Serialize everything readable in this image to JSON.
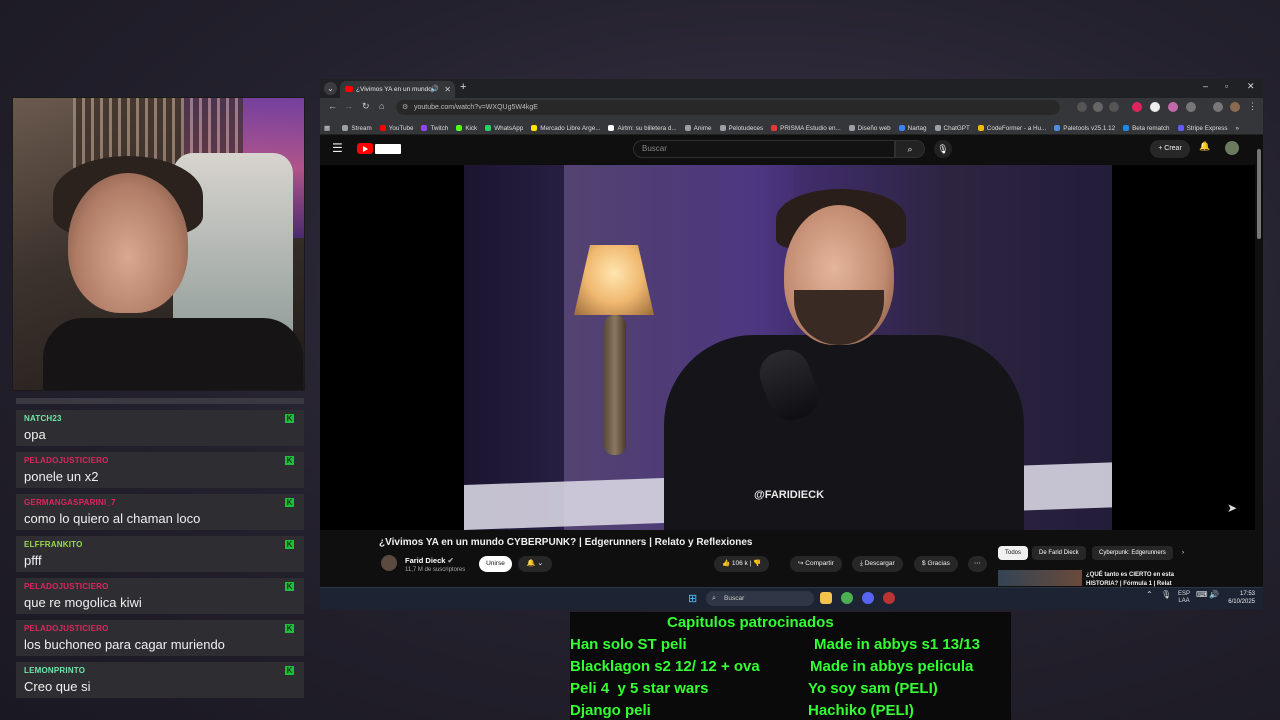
{
  "browser": {
    "tab_title": "¿Vivimos YA en un mundo",
    "url": "youtube.com/watch?v=WXQUg5W4kgE",
    "bookmarks": [
      "Stream",
      "YouTube",
      "Twitch",
      "Kick",
      "WhatsApp",
      "Mercado Libre Arge...",
      "Airtm: su billetera d...",
      "Anime",
      "Pelotudeces",
      "PRISMA Estudio en...",
      "Diseño web",
      "Nartag",
      "ChatGPT",
      "CodeFormer - a Hu...",
      "Paletools v25.1.12",
      "Beta rematch",
      "Stripe Express"
    ],
    "bookmark_colors": [
      "#9aa0a6",
      "#ff0000",
      "#9146ff",
      "#53fc18",
      "#25d366",
      "#ffe600",
      "#ffffff",
      "#9aa0a6",
      "#9aa0a6",
      "#e53935",
      "#9aa0a6",
      "#3b82f6",
      "#9aa0a6",
      "#f5b700",
      "#4a90e2",
      "#1e88e5",
      "#635bff"
    ]
  },
  "youtube": {
    "search_placeholder": "Buscar",
    "create_label": "Crear",
    "video_watermark": "@FARIDIECK",
    "video_title": "¿Vivimos YA en un mundo CYBERPUNK? | Edgerunners | Relato y Reflexiones",
    "channel_name": "Farid Dieck",
    "subscribers": "11,7 M de suscriptores",
    "join_label": "Unirse",
    "likes": "106 k",
    "share_label": "Compartir",
    "download_label": "Descargar",
    "thanks_label": "Gracias",
    "chips": [
      "Todos",
      "De Farid Dieck",
      "Cyberpunk: Edgerunners"
    ],
    "rec_title": "¿QUÉ tanto es CIERTO en esta HISTORIA? | Fórmula 1 | Relat"
  },
  "taskbar": {
    "search_placeholder": "Buscar",
    "lang_top": "ESP",
    "lang_bottom": "LAA",
    "time": "17:53",
    "date": "6/10/2025"
  },
  "chat": {
    "messages": [
      {
        "user": "NATCH23",
        "text": "opa",
        "color": "#6ee7a8"
      },
      {
        "user": "PELADOJUSTICIERO",
        "text": "ponele un x2",
        "color": "#e0245e"
      },
      {
        "user": "GERMANGASPARINI_7",
        "text": "como lo quiero al chaman loco",
        "color": "#e0245e"
      },
      {
        "user": "ELFFRANKITO",
        "text": "pfff",
        "color": "#9ad84a"
      },
      {
        "user": "PELADOJUSTICIERO",
        "text": "que re mogolica kiwi",
        "color": "#e0245e"
      },
      {
        "user": "PELADOJUSTICIERO",
        "text": "los buchoneo para cagar muriendo",
        "color": "#e0245e"
      },
      {
        "user": "LEMONPRINTO",
        "text": "Creo que si",
        "color": "#6ee7a8"
      }
    ]
  },
  "overlay": {
    "title": "Capitulos patrocinados",
    "left": [
      "Han solo ST peli",
      "Blacklagon s2 12/ 12 + ova",
      "Peli 4  y 5 star wars",
      "Django peli"
    ],
    "right": [
      "Made in abbys s1 13/13",
      "Made in abbys pelicula",
      "Yo soy sam (PELI)",
      "Hachiko (PELI)"
    ]
  }
}
